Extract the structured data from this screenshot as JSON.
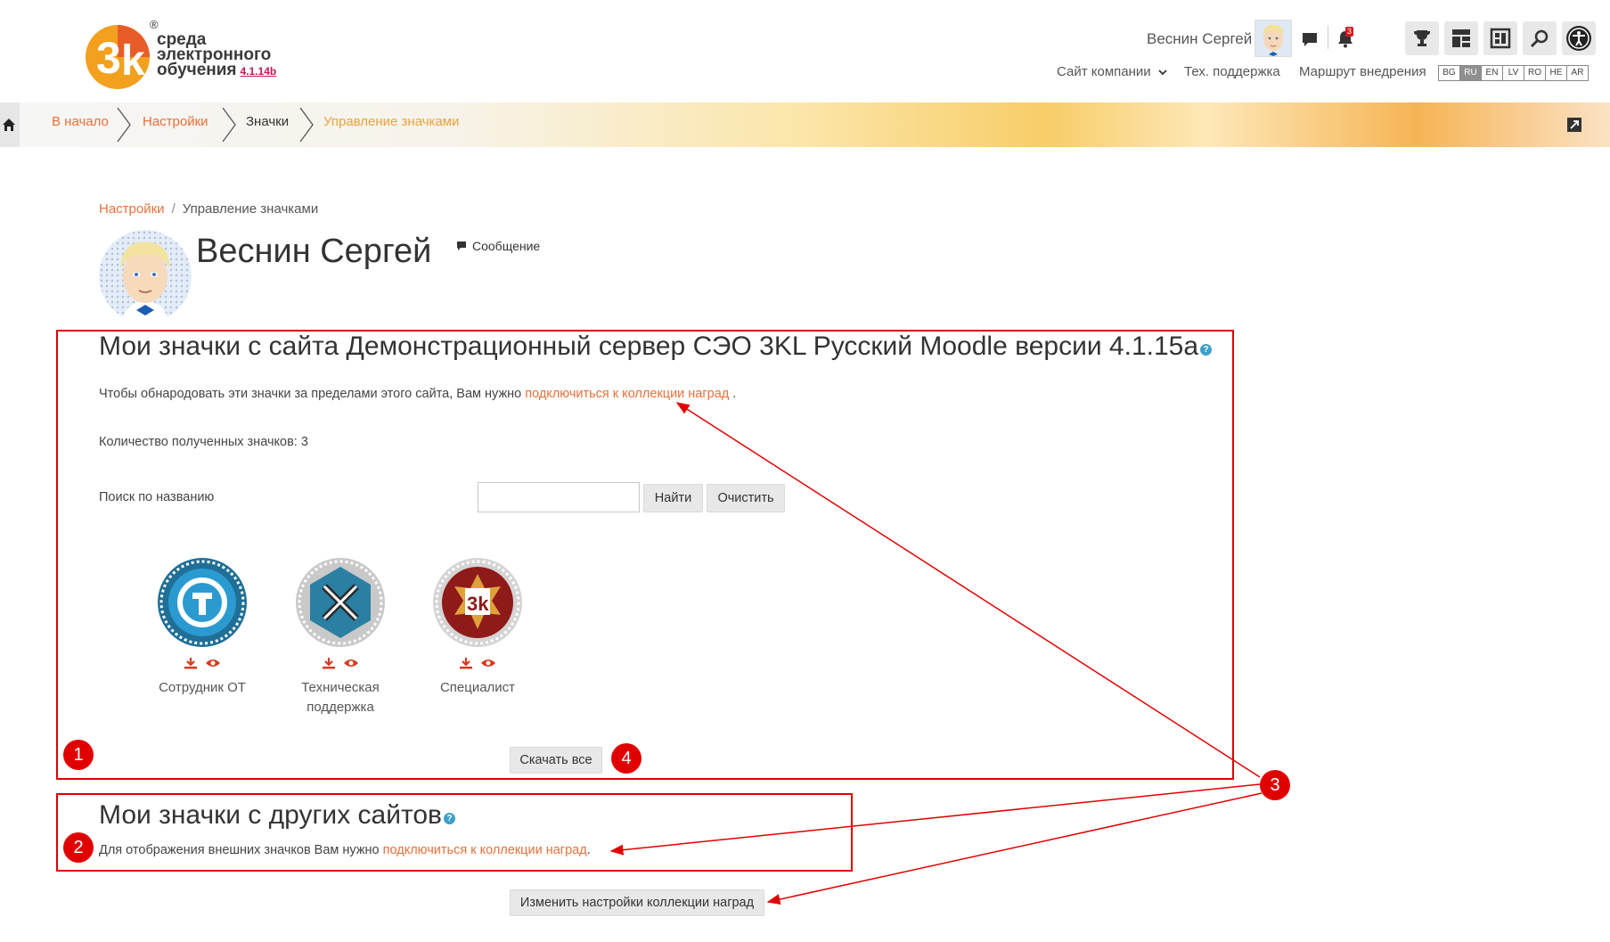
{
  "header": {
    "logo": {
      "line1": "среда",
      "line2": "электронного",
      "line3": "обучения",
      "version": "4.1.14b",
      "reg": "®"
    },
    "user_name": "Веснин Сергей",
    "notification_count": "3",
    "top_links": {
      "company_site": "Сайт компании",
      "support": "Тех. поддержка",
      "roadmap": "Маршрут внедрения"
    },
    "languages": [
      "BG",
      "RU",
      "EN",
      "LV",
      "RO",
      "HE",
      "AR"
    ],
    "active_language": "RU"
  },
  "breadcrumb_bar": {
    "items": [
      "В начало",
      "Настройки",
      "Значки",
      "Управление значками"
    ]
  },
  "page": {
    "breadcrumb": [
      "Настройки",
      "Управление значками"
    ],
    "breadcrumb_sep": "/",
    "profile_name": "Веснин Сергей",
    "message_link": "Сообщение",
    "section1": {
      "title": "Мои значки с сайта Демонстрационный сервер СЭО 3KL Русский Moodle версии 4.1.15a",
      "publish_text": "Чтобы обнародовать эти значки за пределами этого сайта, Вам нужно",
      "publish_link": "подключиться к коллекции наград",
      "publish_end": ".",
      "count_text": "Количество полученных значков: 3",
      "search_label": "Поиск по названию",
      "search_value": "",
      "find_button": "Найти",
      "clear_button": "Очистить",
      "badges": [
        {
          "name": "Сотрудник ОТ"
        },
        {
          "name": "Техническая поддержка"
        },
        {
          "name": "Специалист"
        }
      ],
      "download_all_button": "Скачать все"
    },
    "section2": {
      "title": "Мои значки с других сайтов",
      "text": "Для отображения внешних значков Вам нужно",
      "link": "подключиться к коллекции наград",
      "link_end": "."
    },
    "change_settings_button": "Изменить настройки коллекции наград"
  },
  "annotations": {
    "n1": "1",
    "n2": "2",
    "n3": "3",
    "n4": "4",
    "color": "#e10000"
  },
  "colors": {
    "accent": "#e8703a",
    "annotation_red": "#e10000",
    "help": "#3da0c8"
  }
}
